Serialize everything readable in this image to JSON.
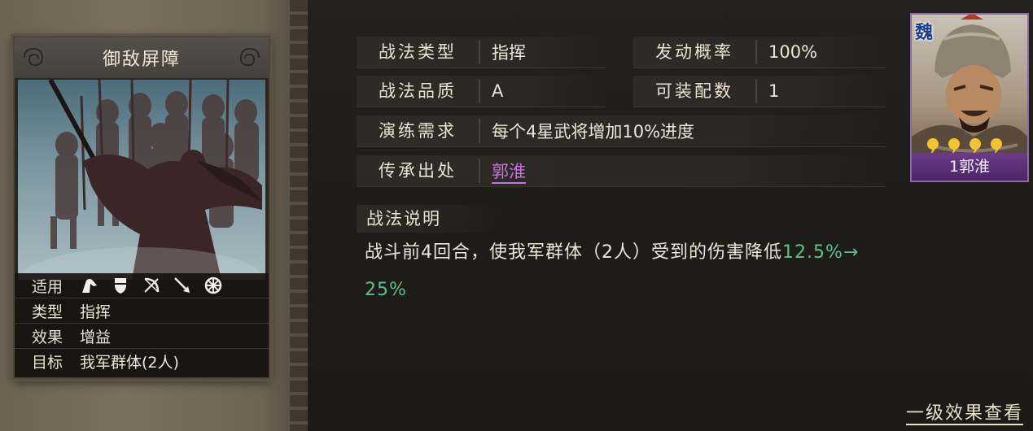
{
  "card": {
    "title": "御敌屏障",
    "rows": [
      {
        "key": "适用",
        "value": ""
      },
      {
        "key": "类型",
        "value": "指挥"
      },
      {
        "key": "效果",
        "value": "增益"
      },
      {
        "key": "目标",
        "value": "我军群体(2人)"
      }
    ],
    "usage_icons": [
      "cavalry-icon",
      "shield-icon",
      "bow-icon",
      "spear-icon",
      "wheel-icon"
    ]
  },
  "details": {
    "type_label": "战法类型",
    "type_value": "指挥",
    "rate_label": "发动概率",
    "rate_value": "100%",
    "quality_label": "战法品质",
    "quality_value": "A",
    "equip_label": "可装配数",
    "equip_value": "1",
    "drill_label": "演练需求",
    "drill_value": "每个4星武将增加10%进度",
    "source_label": "传承出处",
    "source_value": "郭淮"
  },
  "description": {
    "label": "战法说明",
    "text": "战斗前4回合，使我军群体（2人）受到的伤害降低",
    "highlight_1": "12.5%→",
    "highlight_2": "25%"
  },
  "footer": {
    "link": "一级效果查看"
  },
  "general": {
    "faction": "魏",
    "name": "1郭淮",
    "stars": 4
  },
  "colors": {
    "link_purple": "#c872e0",
    "highlight_green": "#5fbf86",
    "frame_purple": "#8a6aa8"
  }
}
